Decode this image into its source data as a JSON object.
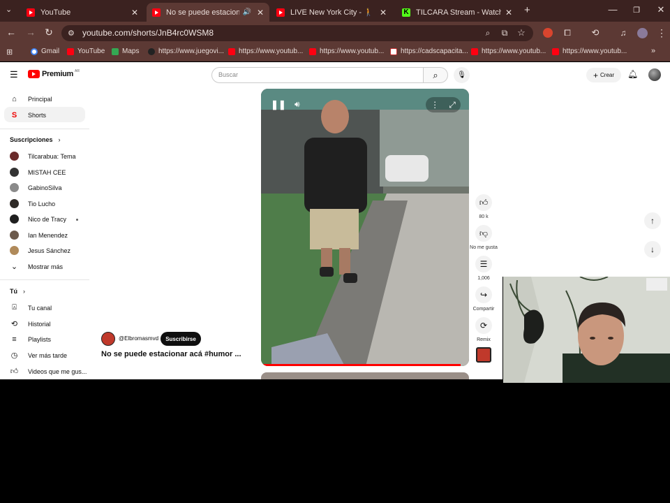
{
  "browser": {
    "tabs": [
      {
        "title": "YouTube",
        "icon": "youtube-favicon"
      },
      {
        "title": "No se puede estacionar acá",
        "icon": "youtube-favicon",
        "active": true
      },
      {
        "title": "LIVE New York City - 🚶 😊 Hot",
        "icon": "youtube-favicon"
      },
      {
        "title": "TILCARA Stream - Watch Live on",
        "icon": "kick-favicon"
      }
    ],
    "new_tab_label": "+",
    "url": "youtube.com/shorts/JnB4rc0WSM8",
    "bookmarks": [
      {
        "label": "Gmail",
        "icon": "gmail-icon"
      },
      {
        "label": "YouTube",
        "icon": "youtube-icon"
      },
      {
        "label": "Maps",
        "icon": "maps-icon"
      },
      {
        "label": "https://www.juegovi...",
        "icon": "site-icon"
      },
      {
        "label": "https://www.youtub...",
        "icon": "youtube-icon"
      },
      {
        "label": "https://www.youtub...",
        "icon": "youtube-icon"
      },
      {
        "label": "https://cadscapacita...",
        "icon": "site-icon"
      },
      {
        "label": "https://www.youtub...",
        "icon": "youtube-icon"
      },
      {
        "label": "https://www.youtub...",
        "icon": "youtube-icon"
      }
    ]
  },
  "youtube": {
    "logo_text": "Premium",
    "logo_badge": "AR",
    "search_placeholder": "Buscar",
    "create_label": "Crear",
    "nav": [
      {
        "label": "Principal",
        "icon": "home-icon"
      },
      {
        "label": "Shorts",
        "icon": "shorts-icon"
      }
    ],
    "subscriptions_title": "Suscripciones",
    "subscriptions": [
      {
        "label": "Tilcarabua: Tema",
        "color": "#6a2b2b"
      },
      {
        "label": "MISTAH CEE",
        "color": "#333333"
      },
      {
        "label": "GabinoSilva",
        "color": "#8a8a8a"
      },
      {
        "label": "Tio Lucho",
        "color": "#2e2a26"
      },
      {
        "label": "Nico de Tracy",
        "color": "#1f1f1f"
      },
      {
        "label": "Ian Menendez",
        "color": "#6c5a4c"
      },
      {
        "label": "Jesus Sánchez",
        "color": "#b08a5a"
      }
    ],
    "show_more": "Mostrar más",
    "you_title": "Tú",
    "you_items": [
      {
        "label": "Tu canal",
        "icon": "account-icon"
      },
      {
        "label": "Historial",
        "icon": "history-icon"
      },
      {
        "label": "Playlists",
        "icon": "playlist-icon"
      },
      {
        "label": "Ver más tarde",
        "icon": "clock-icon"
      },
      {
        "label": "Videos que me gus...",
        "icon": "like-icon"
      }
    ],
    "short": {
      "channel": "@Elbromasmvd",
      "subscribe_label": "Suscribirse",
      "title": "No se puede estacionar acá #humor ...",
      "likes": "80 k",
      "dislike_label": "No me gusta",
      "comments": "1,006",
      "share_label": "Compartir",
      "remix_label": "Remix"
    }
  }
}
